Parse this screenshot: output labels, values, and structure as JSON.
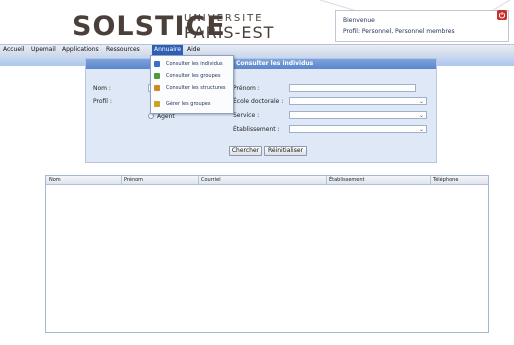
{
  "header": {
    "logo_main": "SOLSTICE",
    "logo_top": "UNIVERSITE",
    "logo_bottom": "PARIS-EST",
    "welcome": "Bienvenue",
    "profile": "Profil: Personnel, Personnel membres"
  },
  "menu": {
    "items": [
      "Accueil",
      "Upemail",
      "Applications",
      "Ressources",
      "Annuaire",
      "Aide"
    ],
    "active": "Annuaire"
  },
  "dropdown": {
    "items": [
      {
        "label": "Consulter les individus",
        "icon": "person-icon",
        "color": "#3b6fc1"
      },
      {
        "label": "Consulter les groupes",
        "icon": "group-icon",
        "color": "#4f9a3a"
      },
      {
        "label": "Consulter les structures",
        "icon": "structure-icon",
        "color": "#d08a25"
      },
      {
        "label": "Gérer les groupes",
        "icon": "manage-group-icon",
        "color": "#c9a227"
      }
    ]
  },
  "form": {
    "title": "Consulter les individus",
    "nom_label": "Nom :",
    "profil_label": "Profil :",
    "agent_label": "Agent",
    "prenom_label": "Prénom :",
    "ecole_label": "École doctorale :",
    "service_label": "Service :",
    "etablissement_label": "Établissement :",
    "search_button": "Chercher",
    "reset_button": "Réinitialiser"
  },
  "results": {
    "columns": [
      "Nom",
      "Prénom",
      "Courriel",
      "Établissement",
      "Téléphone"
    ]
  },
  "colors": {
    "accent": "#2f5fb3",
    "panel": "#dfe8f6",
    "logo": "#4b3f3a",
    "power": "#c9302c"
  }
}
